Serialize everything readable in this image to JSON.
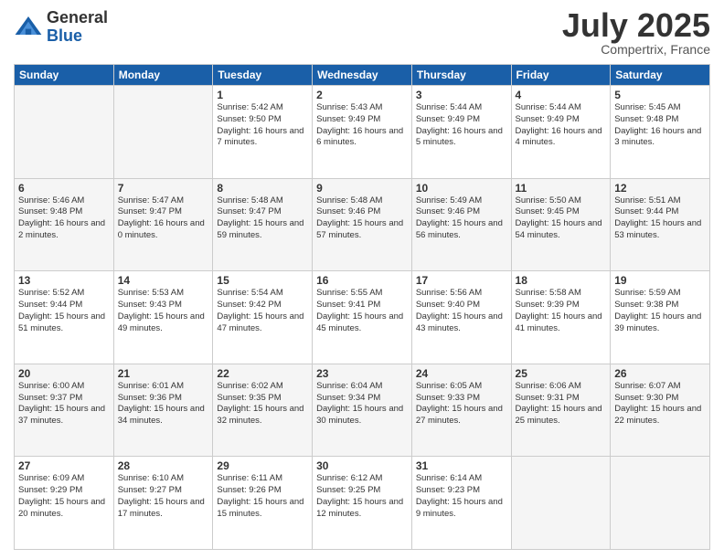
{
  "logo": {
    "general": "General",
    "blue": "Blue"
  },
  "title": {
    "month_year": "July 2025",
    "location": "Compertrix, France"
  },
  "weekdays": [
    "Sunday",
    "Monday",
    "Tuesday",
    "Wednesday",
    "Thursday",
    "Friday",
    "Saturday"
  ],
  "weeks": [
    [
      {
        "day": "",
        "info": "",
        "empty": true
      },
      {
        "day": "",
        "info": "",
        "empty": true
      },
      {
        "day": "1",
        "info": "Sunrise: 5:42 AM\nSunset: 9:50 PM\nDaylight: 16 hours\nand 7 minutes."
      },
      {
        "day": "2",
        "info": "Sunrise: 5:43 AM\nSunset: 9:49 PM\nDaylight: 16 hours\nand 6 minutes."
      },
      {
        "day": "3",
        "info": "Sunrise: 5:44 AM\nSunset: 9:49 PM\nDaylight: 16 hours\nand 5 minutes."
      },
      {
        "day": "4",
        "info": "Sunrise: 5:44 AM\nSunset: 9:49 PM\nDaylight: 16 hours\nand 4 minutes."
      },
      {
        "day": "5",
        "info": "Sunrise: 5:45 AM\nSunset: 9:48 PM\nDaylight: 16 hours\nand 3 minutes."
      }
    ],
    [
      {
        "day": "6",
        "info": "Sunrise: 5:46 AM\nSunset: 9:48 PM\nDaylight: 16 hours\nand 2 minutes."
      },
      {
        "day": "7",
        "info": "Sunrise: 5:47 AM\nSunset: 9:47 PM\nDaylight: 16 hours\nand 0 minutes."
      },
      {
        "day": "8",
        "info": "Sunrise: 5:48 AM\nSunset: 9:47 PM\nDaylight: 15 hours\nand 59 minutes."
      },
      {
        "day": "9",
        "info": "Sunrise: 5:48 AM\nSunset: 9:46 PM\nDaylight: 15 hours\nand 57 minutes."
      },
      {
        "day": "10",
        "info": "Sunrise: 5:49 AM\nSunset: 9:46 PM\nDaylight: 15 hours\nand 56 minutes."
      },
      {
        "day": "11",
        "info": "Sunrise: 5:50 AM\nSunset: 9:45 PM\nDaylight: 15 hours\nand 54 minutes."
      },
      {
        "day": "12",
        "info": "Sunrise: 5:51 AM\nSunset: 9:44 PM\nDaylight: 15 hours\nand 53 minutes."
      }
    ],
    [
      {
        "day": "13",
        "info": "Sunrise: 5:52 AM\nSunset: 9:44 PM\nDaylight: 15 hours\nand 51 minutes."
      },
      {
        "day": "14",
        "info": "Sunrise: 5:53 AM\nSunset: 9:43 PM\nDaylight: 15 hours\nand 49 minutes."
      },
      {
        "day": "15",
        "info": "Sunrise: 5:54 AM\nSunset: 9:42 PM\nDaylight: 15 hours\nand 47 minutes."
      },
      {
        "day": "16",
        "info": "Sunrise: 5:55 AM\nSunset: 9:41 PM\nDaylight: 15 hours\nand 45 minutes."
      },
      {
        "day": "17",
        "info": "Sunrise: 5:56 AM\nSunset: 9:40 PM\nDaylight: 15 hours\nand 43 minutes."
      },
      {
        "day": "18",
        "info": "Sunrise: 5:58 AM\nSunset: 9:39 PM\nDaylight: 15 hours\nand 41 minutes."
      },
      {
        "day": "19",
        "info": "Sunrise: 5:59 AM\nSunset: 9:38 PM\nDaylight: 15 hours\nand 39 minutes."
      }
    ],
    [
      {
        "day": "20",
        "info": "Sunrise: 6:00 AM\nSunset: 9:37 PM\nDaylight: 15 hours\nand 37 minutes."
      },
      {
        "day": "21",
        "info": "Sunrise: 6:01 AM\nSunset: 9:36 PM\nDaylight: 15 hours\nand 34 minutes."
      },
      {
        "day": "22",
        "info": "Sunrise: 6:02 AM\nSunset: 9:35 PM\nDaylight: 15 hours\nand 32 minutes."
      },
      {
        "day": "23",
        "info": "Sunrise: 6:04 AM\nSunset: 9:34 PM\nDaylight: 15 hours\nand 30 minutes."
      },
      {
        "day": "24",
        "info": "Sunrise: 6:05 AM\nSunset: 9:33 PM\nDaylight: 15 hours\nand 27 minutes."
      },
      {
        "day": "25",
        "info": "Sunrise: 6:06 AM\nSunset: 9:31 PM\nDaylight: 15 hours\nand 25 minutes."
      },
      {
        "day": "26",
        "info": "Sunrise: 6:07 AM\nSunset: 9:30 PM\nDaylight: 15 hours\nand 22 minutes."
      }
    ],
    [
      {
        "day": "27",
        "info": "Sunrise: 6:09 AM\nSunset: 9:29 PM\nDaylight: 15 hours\nand 20 minutes."
      },
      {
        "day": "28",
        "info": "Sunrise: 6:10 AM\nSunset: 9:27 PM\nDaylight: 15 hours\nand 17 minutes."
      },
      {
        "day": "29",
        "info": "Sunrise: 6:11 AM\nSunset: 9:26 PM\nDaylight: 15 hours\nand 15 minutes."
      },
      {
        "day": "30",
        "info": "Sunrise: 6:12 AM\nSunset: 9:25 PM\nDaylight: 15 hours\nand 12 minutes."
      },
      {
        "day": "31",
        "info": "Sunrise: 6:14 AM\nSunset: 9:23 PM\nDaylight: 15 hours\nand 9 minutes."
      },
      {
        "day": "",
        "info": "",
        "empty": true
      },
      {
        "day": "",
        "info": "",
        "empty": true
      }
    ]
  ]
}
